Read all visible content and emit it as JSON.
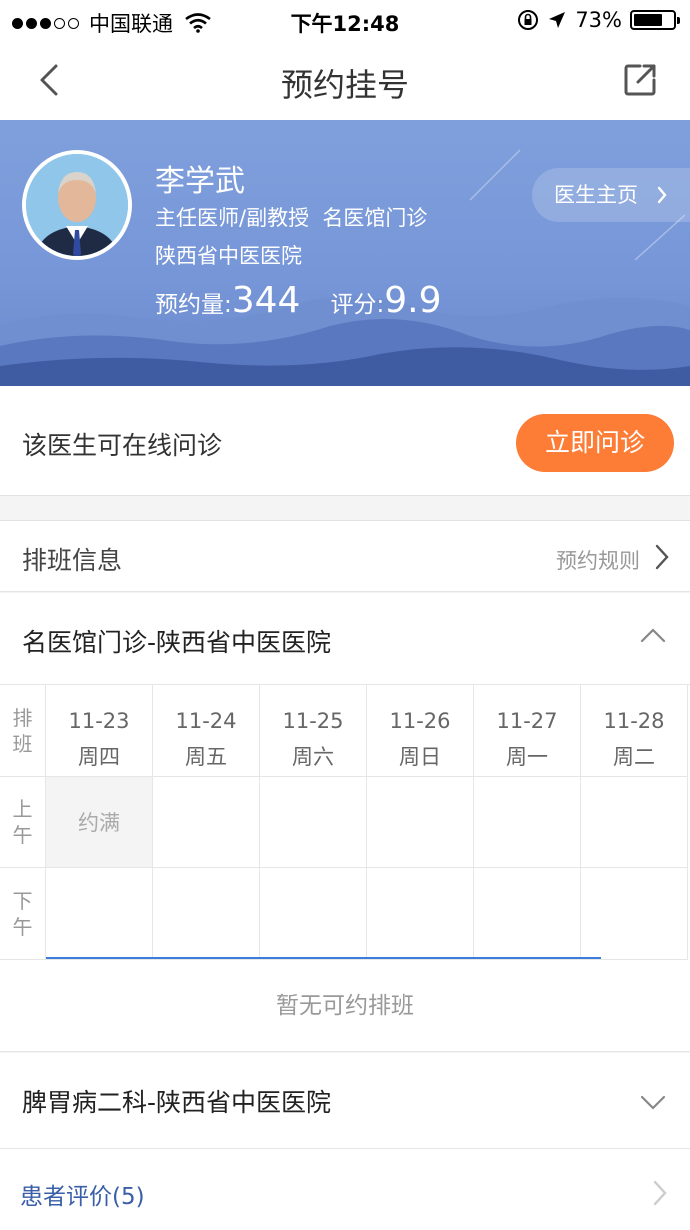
{
  "status_bar": {
    "carrier": "中国联通",
    "time": "下午12:48",
    "battery": "73%",
    "battery_level": 0.73
  },
  "nav": {
    "title": "预约挂号"
  },
  "doctor": {
    "name": "李学武",
    "title": "主任医师/副教授  名医馆门诊",
    "hospital": "陕西省中医医院",
    "appointments_label": "预约量:",
    "appointments": "344",
    "rating_label": "评分:",
    "rating": "9.9",
    "home_button": "医生主页"
  },
  "consult": {
    "label": "该医生可在线问诊",
    "button": "立即问诊"
  },
  "schedule": {
    "header": "排班信息",
    "rules": "预约规则",
    "department1": "名医馆门诊-陕西省中医医院",
    "corner": "排班",
    "morning": "上午",
    "afternoon": "下午",
    "days": [
      {
        "date": "11-23",
        "weekday": "周四",
        "am": "约满",
        "pm": ""
      },
      {
        "date": "11-24",
        "weekday": "周五",
        "am": "",
        "pm": ""
      },
      {
        "date": "11-25",
        "weekday": "周六",
        "am": "",
        "pm": ""
      },
      {
        "date": "11-26",
        "weekday": "周日",
        "am": "",
        "pm": ""
      },
      {
        "date": "11-27",
        "weekday": "周一",
        "am": "",
        "pm": ""
      },
      {
        "date": "11-28",
        "weekday": "周二",
        "am": "",
        "pm": ""
      }
    ],
    "empty_text": "暂无可约排班",
    "department2": "脾胃病二科-陕西省中医医院"
  },
  "reviews": {
    "label": "患者评价(5)"
  },
  "colors": {
    "accent_orange": "#fd7c36",
    "hero_blue": "#7f9fdc",
    "link_blue": "#3a5fa8"
  }
}
